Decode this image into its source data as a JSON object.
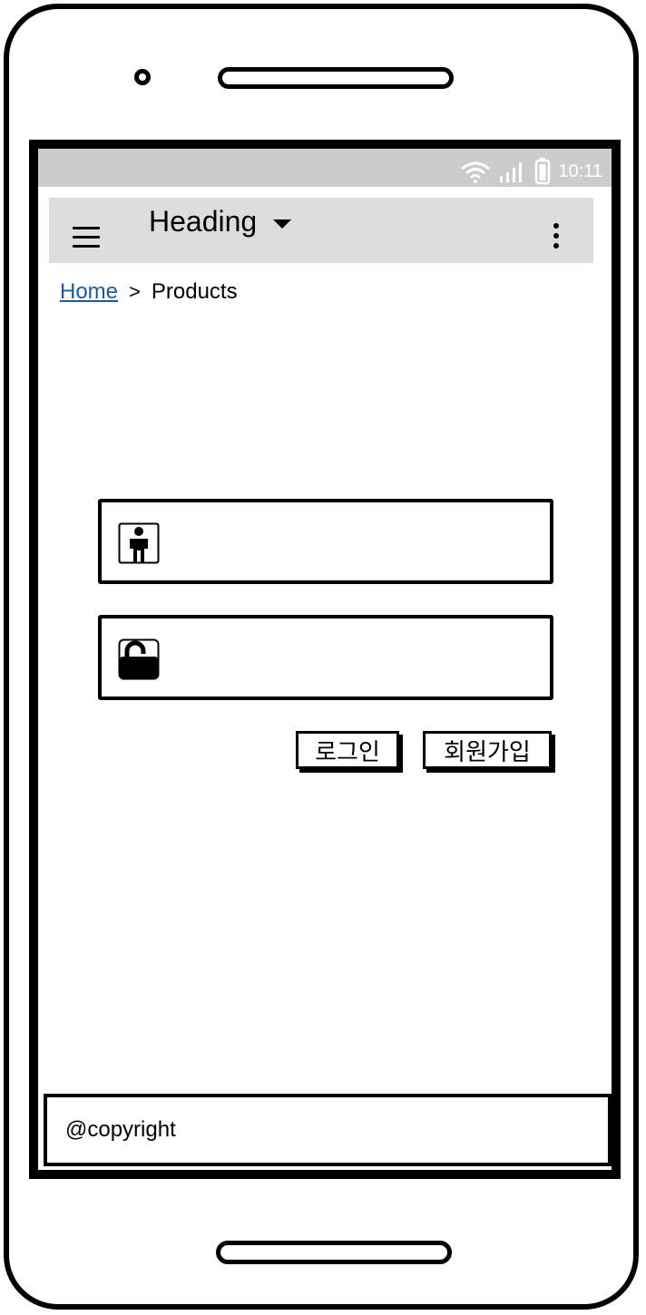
{
  "status_bar": {
    "time": "10:11",
    "icons": [
      "wifi-icon",
      "signal-icon",
      "battery-icon"
    ]
  },
  "app_bar": {
    "heading": "Heading",
    "icons": [
      "menu-icon",
      "caret-down-icon",
      "more-vert-icon"
    ]
  },
  "breadcrumb": {
    "home": "Home",
    "separator": ">",
    "current": "Products"
  },
  "login_form": {
    "username": {
      "icon": "person-icon",
      "value": "",
      "placeholder": ""
    },
    "password": {
      "icon": "unlock-icon",
      "value": "",
      "placeholder": ""
    },
    "login_button": "로그인",
    "signup_button": "회원가입"
  },
  "footer": {
    "text": "@copyright"
  },
  "colors": {
    "status_bar_bg": "#cccccc",
    "app_bar_bg": "#dddddd",
    "link": "#1a5aa0"
  }
}
